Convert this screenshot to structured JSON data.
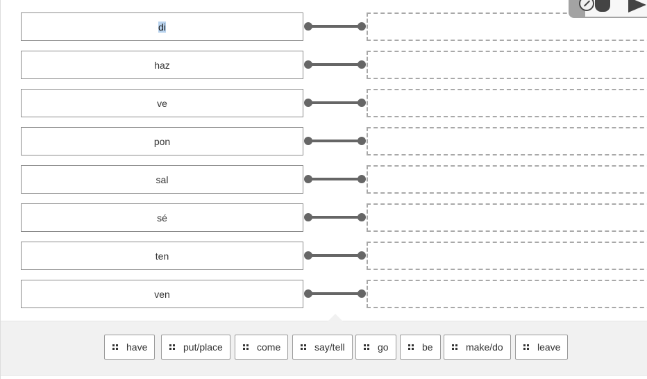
{
  "pairs": [
    {
      "prompt": "di",
      "selected": true
    },
    {
      "prompt": "haz"
    },
    {
      "prompt": "ve"
    },
    {
      "prompt": "pon"
    },
    {
      "prompt": "sal"
    },
    {
      "prompt": "sé"
    },
    {
      "prompt": "ten"
    },
    {
      "prompt": "ven"
    }
  ],
  "answers": [
    "have",
    "put/place",
    "come",
    "say/tell",
    "go",
    "be",
    "make/do",
    "leave"
  ],
  "icons": {
    "chip_handle": "drag-handle-icon",
    "overlay_left": "circle-slash-icon",
    "overlay_middle": "stop-icon",
    "overlay_right": "play-icon"
  },
  "colors": {
    "connector": "#666666",
    "tray": "#f1f1f1",
    "selection": "#b9d3ee"
  }
}
